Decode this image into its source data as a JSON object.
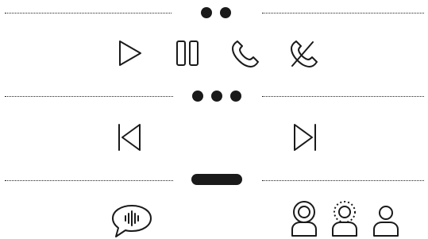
{
  "sections": [
    {
      "indicator": "two-dots",
      "controls": [
        {
          "name": "play",
          "icon": "play-icon"
        },
        {
          "name": "pause",
          "icon": "pause-icon"
        },
        {
          "name": "call",
          "icon": "phone-icon"
        },
        {
          "name": "end-call",
          "icon": "phone-slash-icon"
        }
      ]
    },
    {
      "indicator": "three-dots",
      "controls": [
        {
          "name": "previous",
          "icon": "skip-back-icon"
        },
        {
          "name": "next",
          "icon": "skip-forward-icon"
        }
      ]
    },
    {
      "indicator": "long-pill",
      "controls": [
        {
          "name": "voice-message",
          "icon": "voice-chat-bubble-icon"
        },
        {
          "name": "user-speaking",
          "icon": "user-speaking-icon"
        },
        {
          "name": "user-listening",
          "icon": "user-listening-icon"
        },
        {
          "name": "user",
          "icon": "user-icon"
        }
      ]
    }
  ],
  "colors": {
    "stroke": "#1a1a1a",
    "background": "#ffffff"
  }
}
